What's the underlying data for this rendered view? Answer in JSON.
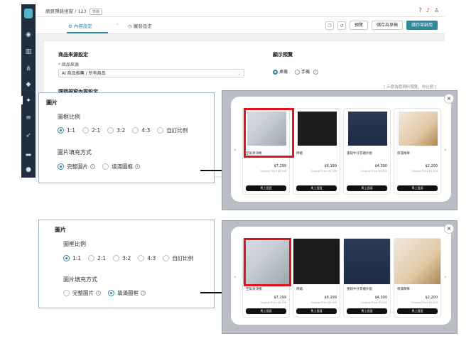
{
  "app": {
    "breadcrumb": "網頁彈跳視窗 / 123",
    "breadcrumb_tag": "草稿",
    "steps": [
      "內容設定",
      "觸發設定"
    ],
    "toolbar": {
      "preview": "預覽",
      "save_draft": "儲存為草稿",
      "save_apply": "儲存並啟用"
    },
    "left_panel": {
      "title": "商品來源設定",
      "source_label": "商品來源",
      "source_value": "AI 商品推薦 / 所有商品",
      "content_title": "彈跳視窗內容設定"
    },
    "right_panel": {
      "title": "顯示預覽",
      "device_options": [
        "桌機",
        "手機"
      ],
      "selected_device": "桌機",
      "note": "[ 示意為假資料預覽，非比例 ]"
    },
    "colors": {
      "accent": "#2b8a9c",
      "sidebar": "#1f2f3f",
      "highlight": "#e3121b"
    }
  },
  "configs": [
    {
      "section_title": "圖片",
      "ratio_label": "圖框比例",
      "ratio_options": [
        "1:1",
        "2:1",
        "3:2",
        "4:3",
        "自訂比例"
      ],
      "ratio_selected": "1:1",
      "fill_label": "圖片填充方式",
      "fill_options": [
        "完整圖片",
        "填滿圖框"
      ],
      "fill_selected": "完整圖片"
    },
    {
      "section_title": "圖片",
      "ratio_label": "圖框比例",
      "ratio_options": [
        "1:1",
        "2:1",
        "3:2",
        "4:3",
        "自訂比例"
      ],
      "ratio_selected": "1:1",
      "fill_label": "圖片填充方式",
      "fill_options": [
        "完整圖片",
        "填滿圖框"
      ],
      "fill_selected": "填滿圖框"
    }
  ],
  "products": [
    {
      "name": "空氣清淨機",
      "price": "$7,299",
      "original": "Original Price $8,299",
      "button": "馬上逛逛",
      "icon": "air-purifier-image"
    },
    {
      "name": "烤箱",
      "price": "$6,199",
      "original": "Original Price $6,399",
      "button": "馬上逛逛",
      "icon": "oven-image"
    },
    {
      "name": "重磅牛仔衣襯外套",
      "price": "$4,300",
      "original": "Original Price $5,000",
      "button": "馬上逛逛",
      "icon": "denim-jacket-image"
    },
    {
      "name": "保濕精華",
      "price": "$2,200",
      "original": "Original Price $2,400",
      "button": "馬上逛逛",
      "icon": "perfume-bottle-image"
    }
  ]
}
